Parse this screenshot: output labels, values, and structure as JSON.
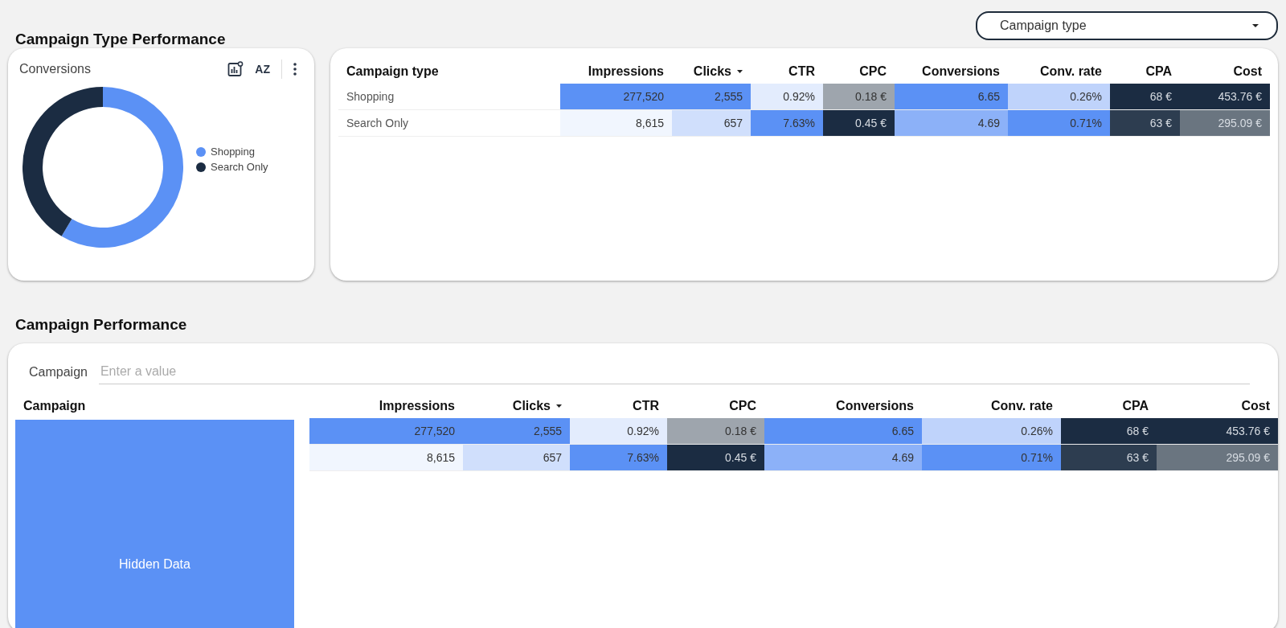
{
  "sections": [
    {
      "title": "Campaign Type Performance"
    },
    {
      "title": "Campaign Performance"
    }
  ],
  "dropdown": {
    "value": "Campaign type"
  },
  "chart_card": {
    "sort_button": "AZ",
    "chart_data": {
      "type": "donut",
      "title": "Conversions",
      "categories": [
        "Shopping",
        "Search Only"
      ],
      "values": [
        58.6,
        41.4
      ],
      "legend": "right",
      "colors": [
        "#5b91f5",
        "#1b2c42"
      ]
    }
  },
  "type_table": {
    "columns": [
      {
        "label": "Campaign type",
        "sorted": false
      },
      {
        "label": "Impressions",
        "sorted": false
      },
      {
        "label": "Clicks",
        "sorted": true
      },
      {
        "label": "CTR",
        "sorted": false
      },
      {
        "label": "CPC",
        "sorted": false
      },
      {
        "label": "Conversions",
        "sorted": false
      },
      {
        "label": "Conv. rate",
        "sorted": false
      },
      {
        "label": "CPA",
        "sorted": false
      },
      {
        "label": "Cost",
        "sorted": false
      }
    ],
    "rows": [
      {
        "cells": [
          {
            "text": "Shopping"
          },
          {
            "text": "277,520",
            "color": "#5b91f5"
          },
          {
            "text": "2,555",
            "color": "#5b91f5"
          },
          {
            "text": "0.92%",
            "color": "#e3ecfd"
          },
          {
            "text": "0.18 €",
            "color": "#9ea5ad"
          },
          {
            "text": "6.65",
            "color": "#5b91f5"
          },
          {
            "text": "0.26%",
            "color": "#bfd3fb"
          },
          {
            "text": "68 €",
            "color": "#1b2c42"
          },
          {
            "text": "453.76 €",
            "color": "#1b2c42"
          }
        ]
      },
      {
        "cells": [
          {
            "text": "Search Only"
          },
          {
            "text": "8,615",
            "color": "#f1f6fe"
          },
          {
            "text": "657",
            "color": "#d0dffc"
          },
          {
            "text": "7.63%",
            "color": "#5b91f5"
          },
          {
            "text": "0.45 €",
            "color": "#1b2c42"
          },
          {
            "text": "4.69",
            "color": "#8cb1f8"
          },
          {
            "text": "0.71%",
            "color": "#5b91f5"
          },
          {
            "text": "63 €",
            "color": "#2d3d50"
          },
          {
            "text": "295.09 €",
            "color": "#6a7580"
          }
        ]
      }
    ]
  },
  "campaign_filter": {
    "label": "Campaign",
    "placeholder": "Enter a value"
  },
  "campaign_table": {
    "columns": [
      {
        "label": "Campaign",
        "sorted": false
      },
      {
        "label": "Impressions",
        "sorted": false
      },
      {
        "label": "Clicks",
        "sorted": true
      },
      {
        "label": "CTR",
        "sorted": false
      },
      {
        "label": "CPC",
        "sorted": false
      },
      {
        "label": "Conversions",
        "sorted": false
      },
      {
        "label": "Conv. rate",
        "sorted": false
      },
      {
        "label": "CPA",
        "sorted": false
      },
      {
        "label": "Cost",
        "sorted": false
      }
    ],
    "hidden_label": "Hidden Data",
    "rows": [
      {
        "cells": [
          {
            "text": ""
          },
          {
            "text": "277,520",
            "color": "#5b91f5"
          },
          {
            "text": "2,555",
            "color": "#5b91f5"
          },
          {
            "text": "0.92%",
            "color": "#e3ecfd"
          },
          {
            "text": "0.18 €",
            "color": "#9ea5ad"
          },
          {
            "text": "6.65",
            "color": "#5b91f5"
          },
          {
            "text": "0.26%",
            "color": "#bfd3fb"
          },
          {
            "text": "68 €",
            "color": "#1b2c42"
          },
          {
            "text": "453.76 €",
            "color": "#1b2c42"
          }
        ]
      },
      {
        "cells": [
          {
            "text": ""
          },
          {
            "text": "8,615",
            "color": "#f1f6fe"
          },
          {
            "text": "657",
            "color": "#d0dffc"
          },
          {
            "text": "7.63%",
            "color": "#5b91f5"
          },
          {
            "text": "0.45 €",
            "color": "#1b2c42"
          },
          {
            "text": "4.69",
            "color": "#8cb1f8"
          },
          {
            "text": "0.71%",
            "color": "#5b91f5"
          },
          {
            "text": "63 €",
            "color": "#2d3d50"
          },
          {
            "text": "295.09 €",
            "color": "#6a7580"
          }
        ]
      }
    ]
  }
}
